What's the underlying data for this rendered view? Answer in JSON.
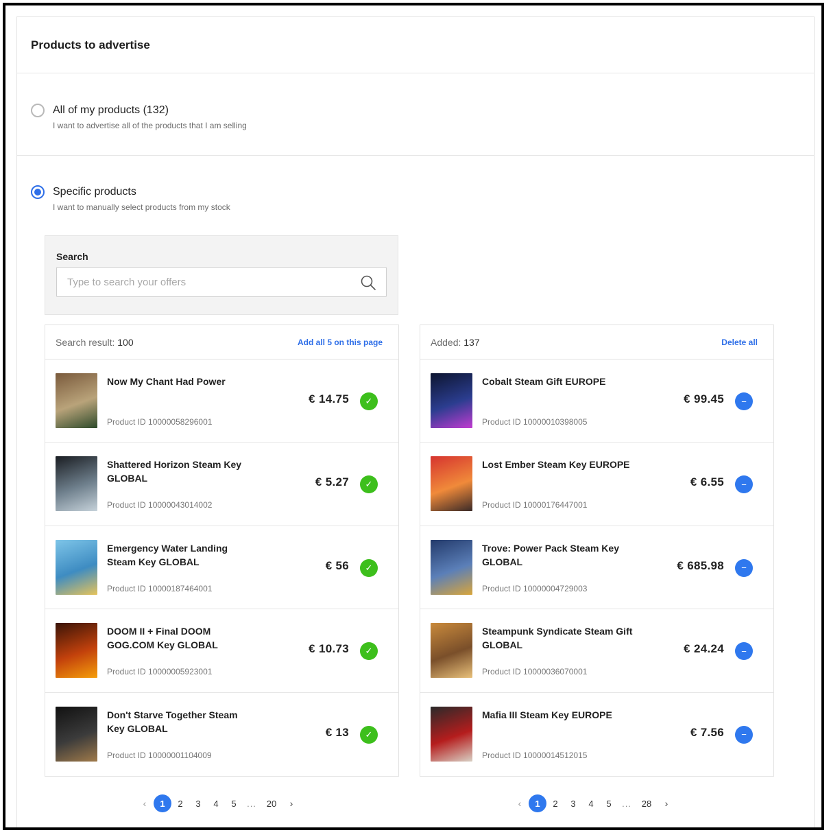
{
  "page": {
    "title": "Products to advertise"
  },
  "options": {
    "all": {
      "label": "All of my products (132)",
      "description": "I want to advertise all of the products that I am selling",
      "selected": false
    },
    "specific": {
      "label": "Specific products",
      "description": "I want to manually select products from my stock",
      "selected": true
    }
  },
  "search": {
    "label": "Search",
    "placeholder": "Type to search your offers",
    "value": ""
  },
  "results": {
    "count_label": "Search result:",
    "count": "100",
    "action": "Add all 5 on this page",
    "items": [
      {
        "name": "Now My Chant Had Power",
        "product_id": "Product ID 10000058296001",
        "price": "€ 14.75",
        "thumb_colors": [
          "#7a5a3c",
          "#b9a37a",
          "#2d4a2a"
        ]
      },
      {
        "name": "Shattered Horizon Steam Key GLOBAL",
        "product_id": "Product ID 10000043014002",
        "price": "€ 5.27",
        "thumb_colors": [
          "#1a1d22",
          "#6e7f8c",
          "#c6d2da"
        ]
      },
      {
        "name": "Emergency Water Landing Steam Key GLOBAL",
        "product_id": "Product ID 10000187464001",
        "price": "€ 56",
        "thumb_colors": [
          "#7ec5e8",
          "#3e8cc2",
          "#e6c35a"
        ]
      },
      {
        "name": "DOOM II + Final DOOM GOG.COM Key GLOBAL",
        "product_id": "Product ID 10000005923001",
        "price": "€ 10.73",
        "thumb_colors": [
          "#3a1408",
          "#c2410c",
          "#f59e0b"
        ]
      },
      {
        "name": "Don't Starve Together Steam Key GLOBAL",
        "product_id": "Product ID 10000001104009",
        "price": "€ 13",
        "thumb_colors": [
          "#111111",
          "#3b3b3b",
          "#a07a4a"
        ]
      }
    ]
  },
  "added": {
    "count_label": "Added:",
    "count": "137",
    "action": "Delete all",
    "items": [
      {
        "name": "Cobalt Steam Gift EUROPE",
        "product_id": "Product ID 10000010398005",
        "price": "€ 99.45",
        "thumb_colors": [
          "#0d1530",
          "#2b3d8f",
          "#c13bd1"
        ]
      },
      {
        "name": "Lost Ember Steam Key EUROPE",
        "product_id": "Product ID 10000176447001",
        "price": "€ 6.55",
        "thumb_colors": [
          "#d6342f",
          "#f08a3a",
          "#3a2a28"
        ]
      },
      {
        "name": "Trove: Power Pack Steam Key GLOBAL",
        "product_id": "Product ID 10000004729003",
        "price": "€ 685.98",
        "thumb_colors": [
          "#233a6b",
          "#5b7fb8",
          "#d9a53b"
        ]
      },
      {
        "name": "Steampunk Syndicate Steam Gift GLOBAL",
        "product_id": "Product ID 10000036070001",
        "price": "€ 24.24",
        "thumb_colors": [
          "#c98a3c",
          "#7a4f2a",
          "#e8c07a"
        ]
      },
      {
        "name": "Mafia III Steam Key EUROPE",
        "product_id": "Product ID 10000014512015",
        "price": "€ 7.56",
        "thumb_colors": [
          "#2a2a2a",
          "#b51d1d",
          "#d8d0c4"
        ]
      }
    ]
  },
  "pagination_left": {
    "pages": [
      "1",
      "2",
      "3",
      "4",
      "5"
    ],
    "ellipsis": "...",
    "last": "20",
    "current": "1"
  },
  "pagination_right": {
    "pages": [
      "1",
      "2",
      "3",
      "4",
      "5"
    ],
    "ellipsis": "...",
    "last": "28",
    "current": "1"
  },
  "colors": {
    "accent": "#2f78ee",
    "check": "#3dbf1c"
  },
  "icons": {
    "search": "search-icon",
    "check": "check-icon",
    "minus": "minus-icon",
    "prev": "chevron-left-icon",
    "next": "chevron-right-icon"
  }
}
